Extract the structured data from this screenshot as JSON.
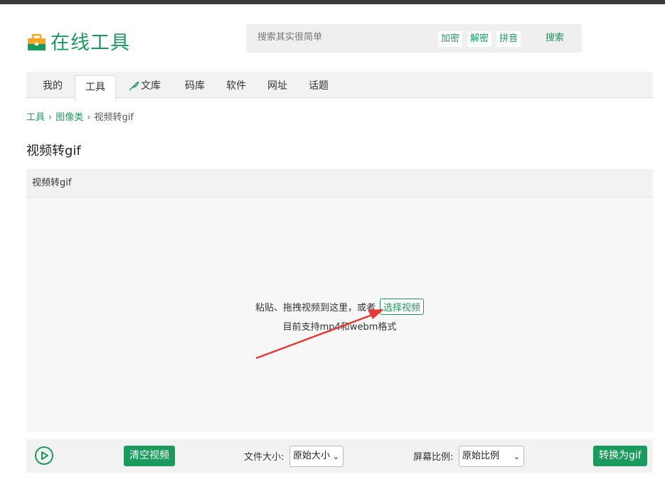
{
  "site": {
    "title": "在线工具"
  },
  "search": {
    "placeholder": "搜索其实很简单",
    "quick_links": [
      "加密",
      "解密",
      "拼音"
    ],
    "button": "搜索"
  },
  "nav": {
    "tabs": [
      {
        "label": "我的"
      },
      {
        "label": "工具",
        "active": true
      },
      {
        "label": "文库"
      },
      {
        "label": "码库"
      },
      {
        "label": "软件"
      },
      {
        "label": "网址"
      },
      {
        "label": "话题"
      }
    ]
  },
  "breadcrumb": {
    "items": [
      "工具",
      "图像类",
      "视频转gif"
    ],
    "separator": "›"
  },
  "page": {
    "title": "视频转gif"
  },
  "panel": {
    "header": "视频转gif",
    "drop_text": "粘贴、拖拽视频到这里，或者",
    "pick_button": "选择视频",
    "support_text": "目前支持mp4和webm格式"
  },
  "toolbar": {
    "clear_button": "清空视频",
    "file_size_label": "文件大小:",
    "file_size_value": "原始大小",
    "ratio_label": "屏幕比例:",
    "ratio_value": "原始比例",
    "convert_button": "转换为gif"
  },
  "colors": {
    "accent": "#1a9a5c",
    "annotation_arrow": "#e53935"
  },
  "icons": {
    "logo": "toolbox-icon",
    "play": "play-icon",
    "wenku": "feather-icon"
  }
}
